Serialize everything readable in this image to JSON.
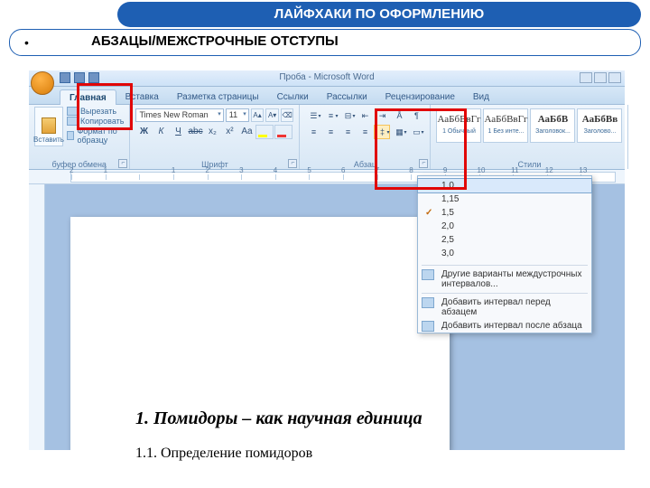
{
  "slide": {
    "header": "ЛАЙФХАКИ ПО ОФОРМЛЕНИЮ",
    "bullet": "•",
    "subtitle": "АБЗАЦЫ/МЕЖСТРОЧНЫЕ ОТСТУПЫ"
  },
  "window": {
    "title": "Проба - Microsoft Word"
  },
  "tabs": {
    "home": "Главная",
    "insert": "Вставка",
    "layout": "Разметка страницы",
    "refs": "Ссылки",
    "mail": "Рассылки",
    "review": "Рецензирование",
    "view": "Вид"
  },
  "clipboard": {
    "paste": "Вставить",
    "cut": "Вырезать",
    "copy": "Копировать",
    "painter": "Формат по образцу",
    "group": "буфер обмена"
  },
  "font": {
    "name": "Times New Roman",
    "size": "11",
    "group": "Шрифт"
  },
  "paragraph": {
    "group": "Абзац"
  },
  "styles": {
    "group": "Стили",
    "sample": "АаБбВвГг",
    "sample_bold": "АаБбВ",
    "sample_em": "АаБбВв",
    "s1": "1 Обычный",
    "s2": "1 Без инте...",
    "s3": "Заголовок...",
    "s4": "Заголово..."
  },
  "spacing": {
    "o1": "1,0",
    "o2": "1,15",
    "o3": "1,5",
    "o4": "2,0",
    "o5": "2,5",
    "o6": "3,0",
    "opts": "Другие варианты междустрочных интервалов...",
    "before": "Добавить интервал перед абзацем",
    "after": "Добавить интервал после абзаца"
  },
  "ruler": [
    "2",
    "1",
    "",
    "1",
    "2",
    "3",
    "4",
    "5",
    "6",
    "7",
    "8",
    "9",
    "10",
    "11",
    "12",
    "13"
  ],
  "doc": {
    "h1": "1. Помидоры – как научная единица",
    "h2": "1.1. Определение помидоров"
  }
}
